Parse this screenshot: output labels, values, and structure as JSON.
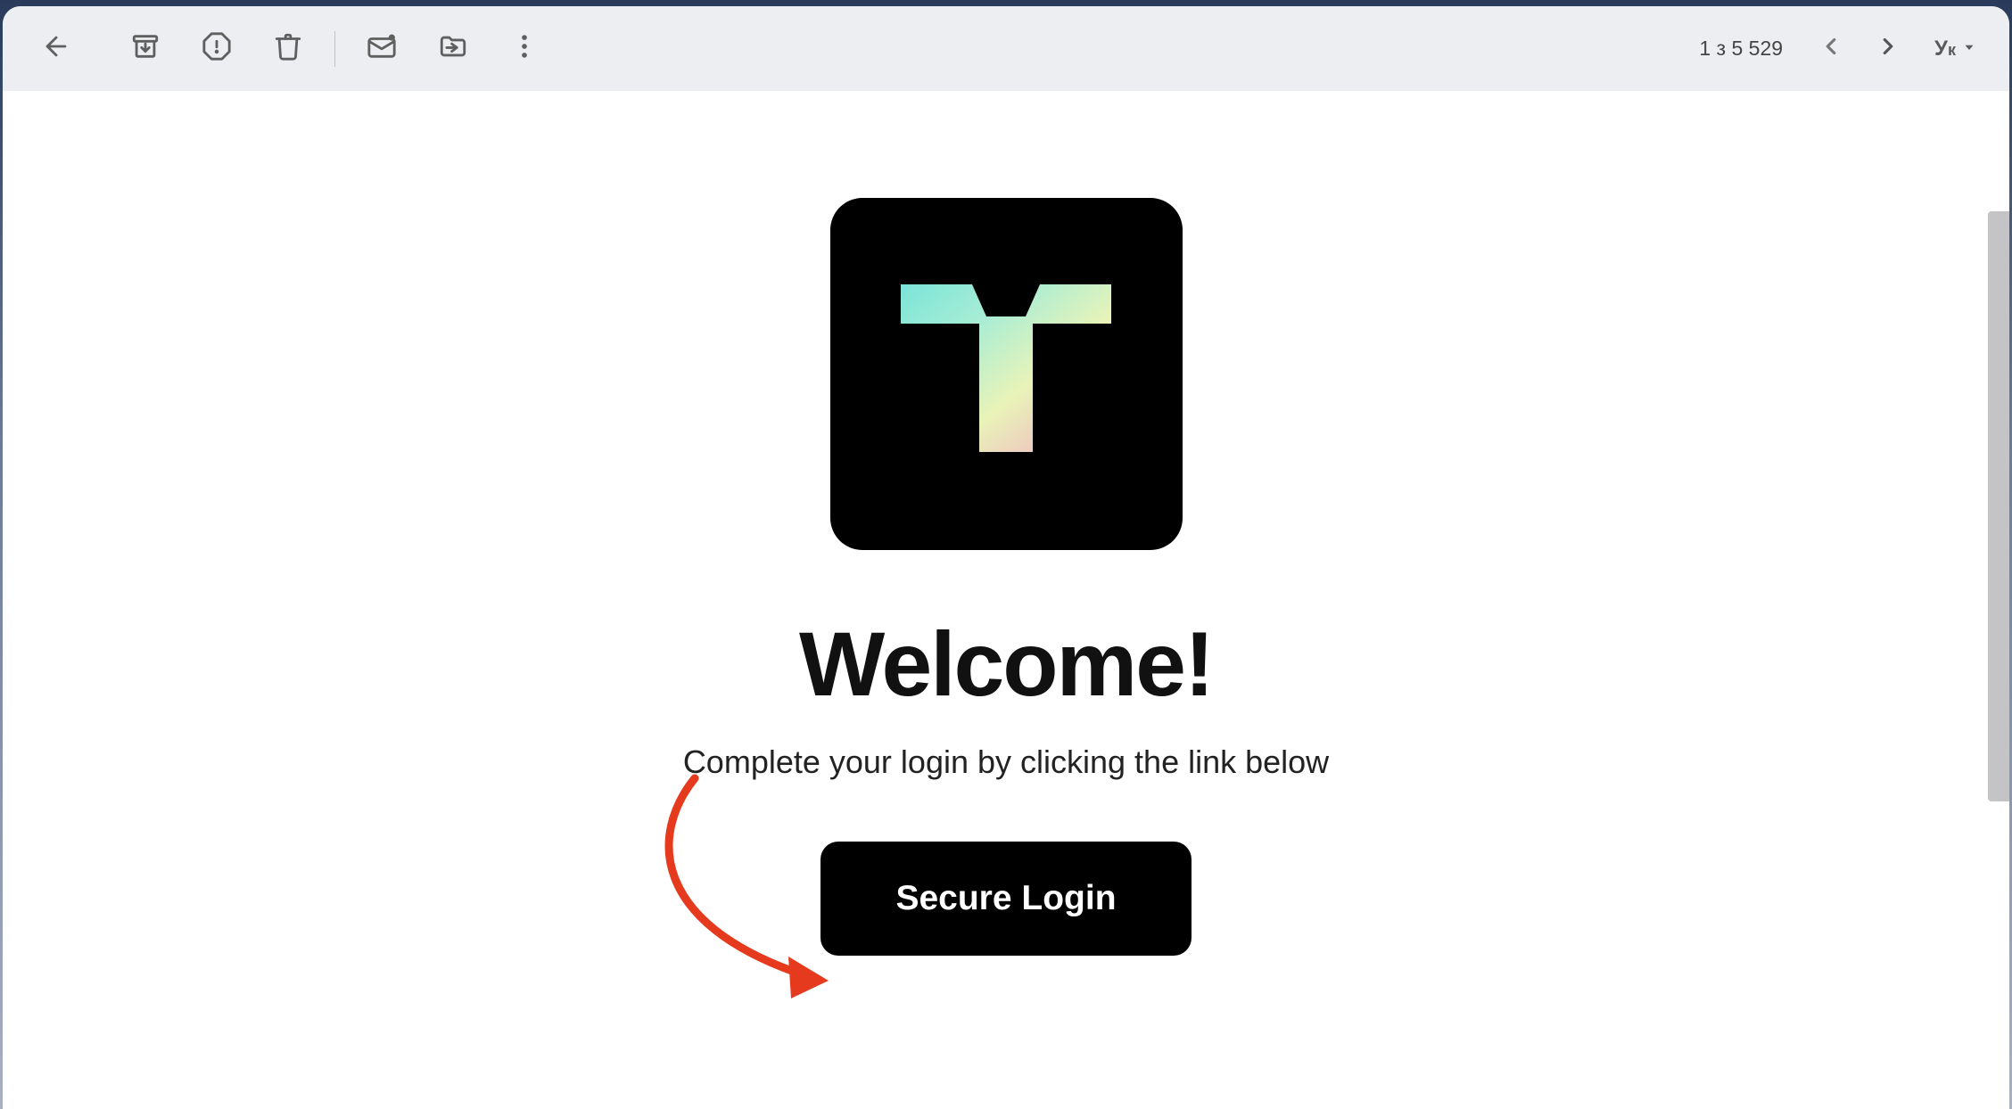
{
  "toolbar": {
    "counter": "1 з 5 529",
    "language": {
      "main": "У",
      "sub": "к"
    }
  },
  "content": {
    "heading": "Welcome!",
    "subheading": "Complete your login by clicking the link below",
    "login_button": "Secure Login"
  },
  "colors": {
    "arrow": "#e63a1e",
    "logo_bg": "#000000"
  }
}
